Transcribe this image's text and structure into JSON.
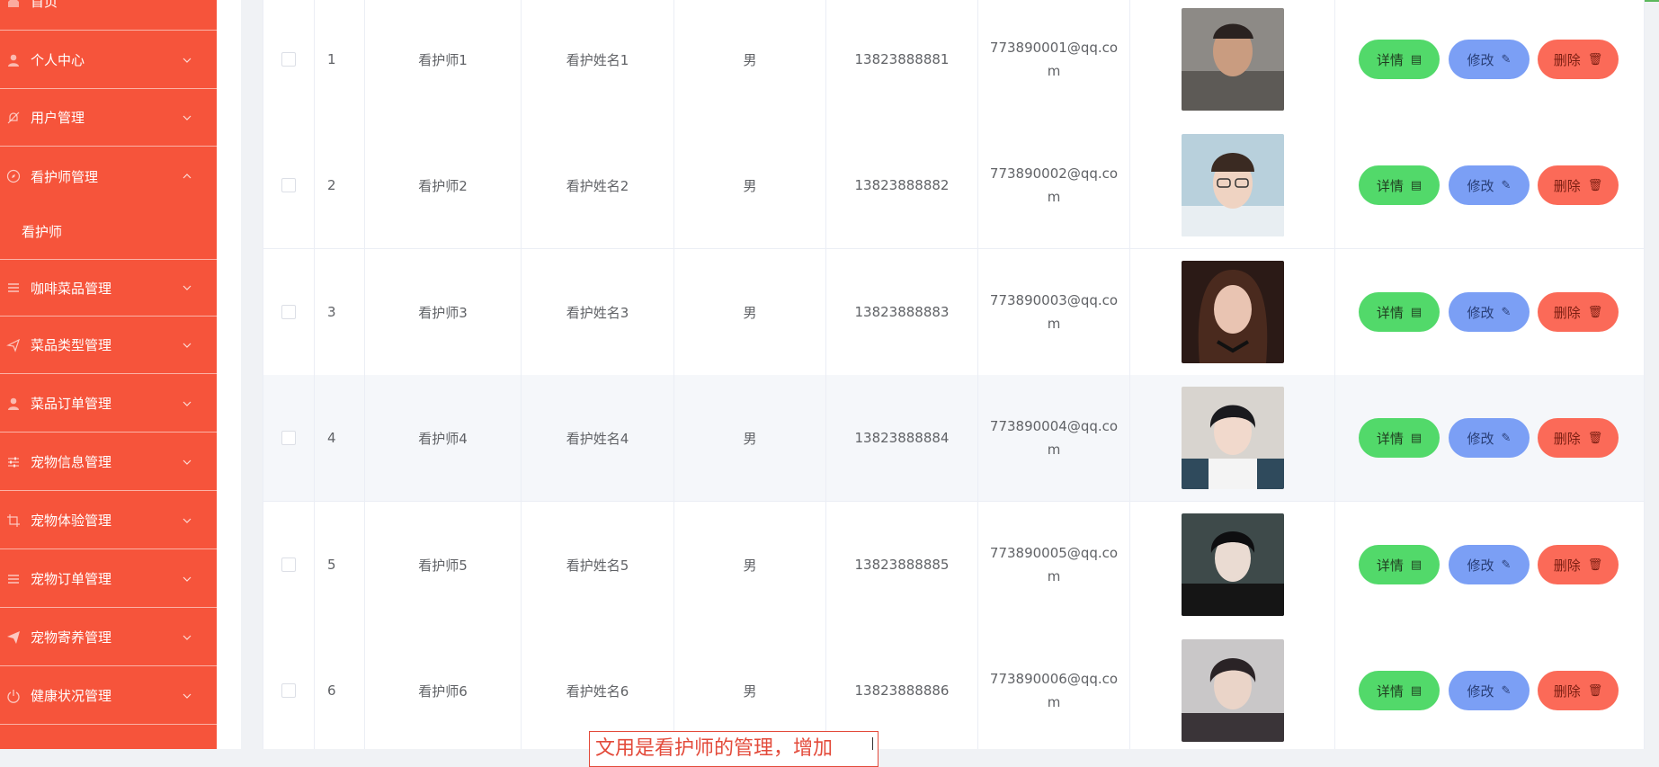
{
  "sidebar": {
    "items": [
      {
        "label": "首页",
        "icon": "home-icon",
        "expanded": false
      },
      {
        "label": "个人中心",
        "icon": "user-icon",
        "expanded": false
      },
      {
        "label": "用户管理",
        "icon": "bell-off-icon",
        "expanded": false
      },
      {
        "label": "看护师管理",
        "icon": "compass-icon",
        "expanded": true
      },
      {
        "label": "咖啡菜品管理",
        "icon": "list-icon",
        "expanded": false
      },
      {
        "label": "菜品类型管理",
        "icon": "send-icon",
        "expanded": false
      },
      {
        "label": "菜品订单管理",
        "icon": "user-icon",
        "expanded": false
      },
      {
        "label": "宠物信息管理",
        "icon": "sliders-icon",
        "expanded": false
      },
      {
        "label": "宠物体验管理",
        "icon": "crop-icon",
        "expanded": false
      },
      {
        "label": "宠物订单管理",
        "icon": "list-icon",
        "expanded": false
      },
      {
        "label": "宠物寄养管理",
        "icon": "paper-plane-icon",
        "expanded": false
      },
      {
        "label": "健康状况管理",
        "icon": "power-icon",
        "expanded": false
      }
    ],
    "submenu": {
      "label": "看护师"
    }
  },
  "table": {
    "rows": [
      {
        "index": "1",
        "account": "看护师1",
        "name": "看护姓名1",
        "gender": "男",
        "phone": "13823888881",
        "email": "773890001@qq.com",
        "selected": false
      },
      {
        "index": "2",
        "account": "看护师2",
        "name": "看护姓名2",
        "gender": "男",
        "phone": "13823888882",
        "email": "773890002@qq.com",
        "selected": false
      },
      {
        "index": "3",
        "account": "看护师3",
        "name": "看护姓名3",
        "gender": "男",
        "phone": "13823888883",
        "email": "773890003@qq.com",
        "selected": false
      },
      {
        "index": "4",
        "account": "看护师4",
        "name": "看护姓名4",
        "gender": "男",
        "phone": "13823888884",
        "email": "773890004@qq.com",
        "selected": false
      },
      {
        "index": "5",
        "account": "看护师5",
        "name": "看护姓名5",
        "gender": "男",
        "phone": "13823888885",
        "email": "773890005@qq.com",
        "selected": false
      },
      {
        "index": "6",
        "account": "看护师6",
        "name": "看护姓名6",
        "gender": "男",
        "phone": "13823888886",
        "email": "773890006@qq.com",
        "selected": false
      }
    ],
    "actions": {
      "detail": "详情",
      "edit": "修改",
      "delete": "删除"
    }
  },
  "annotation": {
    "text": "文用是看护师的管理，增加"
  },
  "colors": {
    "sidebar": "#f6543b",
    "detail": "#52d96a",
    "edit": "#7b9ff5",
    "delete": "#fb6a58"
  }
}
